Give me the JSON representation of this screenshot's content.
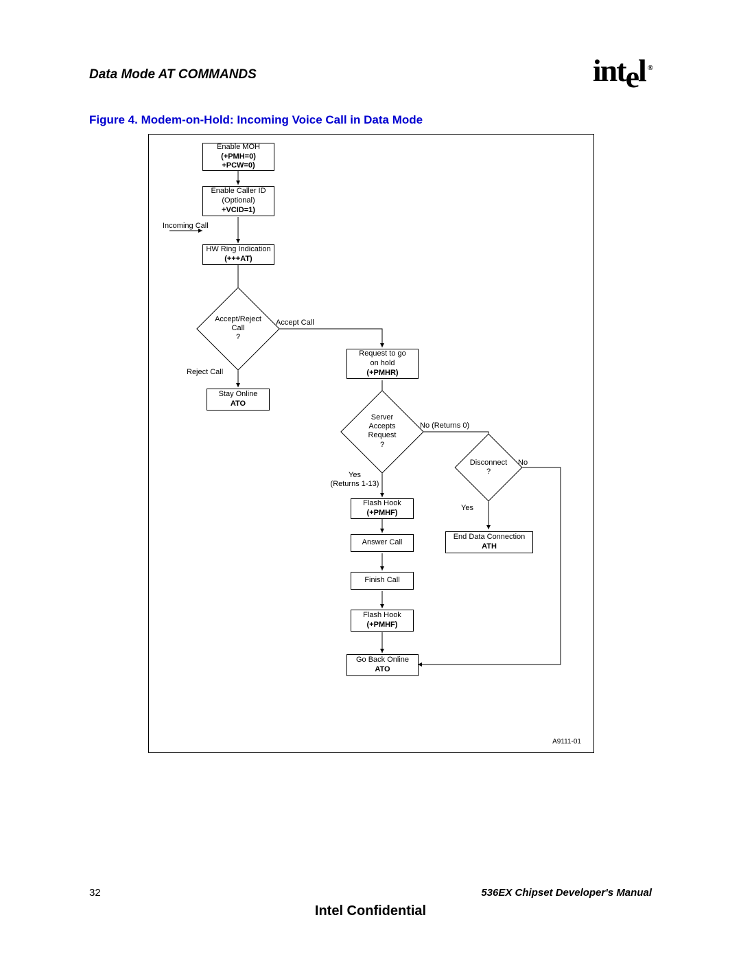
{
  "header": {
    "section": "Data Mode AT COMMANDS",
    "logo": "intel",
    "reg": "®"
  },
  "caption": "Figure 4.  Modem-on-Hold: Incoming Voice Call in Data Mode",
  "nodes": {
    "n1a": "Enable MOH",
    "n1b": "(+PMH=0)",
    "n1c": "+PCW=0)",
    "n2a": "Enable Caller ID",
    "n2b": "(Optional)",
    "n2c": "+VCID=1)",
    "n3a": "HW Ring Indication",
    "n3b": "(+++AT)",
    "d1": "Accept/Reject\nCall\n?",
    "n4a": "Stay Online",
    "n4b": "ATO",
    "n5a": "Request to go",
    "n5b": "on hold",
    "n5c": "(+PMHR)",
    "d2": "Server\nAccepts\nRequest\n?",
    "n6a": "Flash Hook",
    "n6b": "(+PMHF)",
    "n7": "Answer Call",
    "n8": "Finish Call",
    "n9a": "Flash Hook",
    "n9b": "(+PMHF)",
    "n10a": "Go Back Online",
    "n10b": "ATO",
    "d3": "Disconnect\n?",
    "n11a": "End Data Connection",
    "n11b": "ATH"
  },
  "labels": {
    "incoming": "Incoming Call",
    "accept": "Accept Call",
    "reject": "Reject Call",
    "yes1a": "Yes",
    "yes1b": "(Returns 1-13)",
    "no1": "No (Returns 0)",
    "yes2": "Yes",
    "no2": "No"
  },
  "fignum": "A9111-01",
  "footer": {
    "page": "32",
    "manual": "536EX Chipset Developer's Manual"
  },
  "confidential": "Intel Confidential"
}
